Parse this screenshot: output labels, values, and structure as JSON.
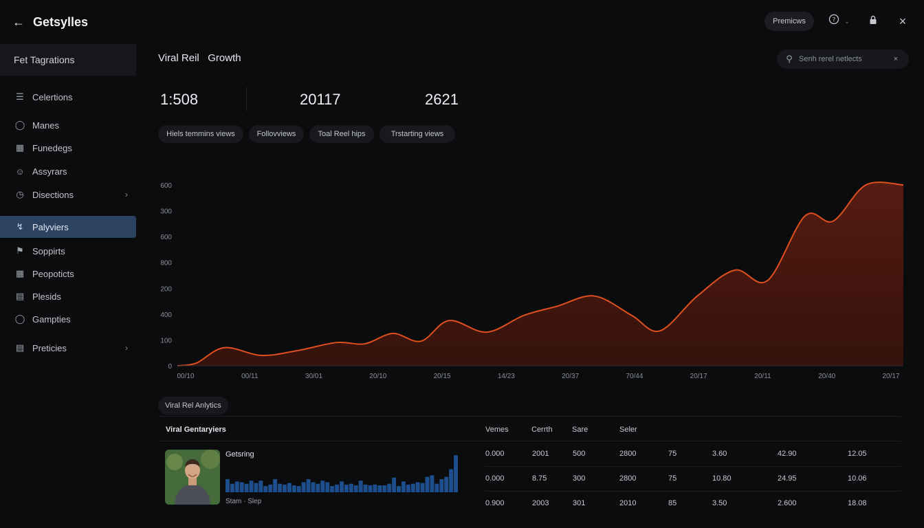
{
  "app": {
    "title": "Getsylles",
    "premium_label": "Premicws"
  },
  "sidebar": {
    "header": "Fet Tagrations",
    "items": [
      {
        "label": "Celertions",
        "icon": "collections-icon"
      },
      {
        "label": "Manes",
        "icon": "chat-icon"
      },
      {
        "label": "Funedegs",
        "icon": "document-icon"
      },
      {
        "label": "Assyrars",
        "icon": "user-icon"
      },
      {
        "label": "Disections",
        "icon": "clock-icon",
        "has_chevron": true
      },
      {
        "label": "Palyviers",
        "icon": "lightning-icon",
        "active": true
      },
      {
        "label": "Soppirts",
        "icon": "flag-icon"
      },
      {
        "label": "Peopoticts",
        "icon": "people-icon"
      },
      {
        "label": "Plesids",
        "icon": "stack-icon"
      },
      {
        "label": "Gampties",
        "icon": "face-icon"
      },
      {
        "label": "Preticies",
        "icon": "page-icon",
        "has_chevron": true
      }
    ]
  },
  "main": {
    "title": "Viral Reil   Growth",
    "search_placeholder": "Senh rerel netlects",
    "stats": [
      "1:508",
      "20117",
      "2621"
    ],
    "chips": [
      "Hiels temmins views",
      "Follovviews",
      "Toal Reel hips",
      "Trstarting views"
    ],
    "section_label": "Viral Rel Anlytics"
  },
  "chart_data": {
    "type": "area",
    "y_tick_labels": [
      "0",
      "100",
      "400",
      "200",
      "800",
      "600",
      "300",
      "600"
    ],
    "x_tick_labels": [
      "00/10",
      "00/11",
      "30/01",
      "20/10",
      "20/15",
      "14/23",
      "20/37",
      "70/44",
      "20/17",
      "20/11",
      "20/40",
      "20/17"
    ],
    "y_range": [
      0,
      7
    ],
    "points": [
      [
        0,
        0
      ],
      [
        0.4,
        0.1
      ],
      [
        1,
        0.7
      ],
      [
        1.8,
        0.4
      ],
      [
        2.6,
        0.6
      ],
      [
        3.4,
        0.9
      ],
      [
        4,
        0.85
      ],
      [
        4.6,
        1.25
      ],
      [
        5.2,
        0.95
      ],
      [
        5.8,
        1.75
      ],
      [
        6.6,
        1.3
      ],
      [
        7.4,
        1.95
      ],
      [
        8.1,
        2.3
      ],
      [
        8.9,
        2.7
      ],
      [
        9.7,
        1.95
      ],
      [
        10.3,
        1.35
      ],
      [
        11.1,
        2.7
      ],
      [
        11.9,
        3.7
      ],
      [
        12.6,
        3.3
      ],
      [
        13.4,
        5.8
      ],
      [
        14.0,
        5.6
      ],
      [
        14.7,
        7.0
      ],
      [
        15.5,
        7.0
      ]
    ],
    "line_color": "#e0501f",
    "fill_color": "#5a1c12",
    "grid": false
  },
  "table": {
    "list_title": "Viral Gentaryiers",
    "headers": [
      "Vemes",
      "Cerrth",
      "Sare",
      "Seler"
    ],
    "card": {
      "name": "Getsring",
      "actions": "Stam  ·  Slep",
      "mini_bars": [
        0.34,
        0.22,
        0.28,
        0.26,
        0.22,
        0.3,
        0.24,
        0.3,
        0.16,
        0.2,
        0.34,
        0.22,
        0.2,
        0.24,
        0.18,
        0.16,
        0.26,
        0.34,
        0.26,
        0.22,
        0.3,
        0.26,
        0.16,
        0.2,
        0.28,
        0.2,
        0.22,
        0.18,
        0.3,
        0.2,
        0.18,
        0.2,
        0.18,
        0.18,
        0.22,
        0.38,
        0.16,
        0.28,
        0.2,
        0.22,
        0.26,
        0.24,
        0.4,
        0.44,
        0.22,
        0.34,
        0.4,
        0.6,
        0.96
      ],
      "bar_color": "#1d4f8f"
    },
    "rows": [
      [
        "0.000",
        "2001",
        "500",
        "2800",
        "75",
        "3.60",
        "42.90",
        "12.05"
      ],
      [
        "0.000",
        "8.75",
        "300",
        "2800",
        "75",
        "10.80",
        "24.95",
        "10.06"
      ],
      [
        "0.900",
        "2003",
        "301",
        "2010",
        "85",
        "3.50",
        "2.600",
        "18.08"
      ]
    ]
  }
}
